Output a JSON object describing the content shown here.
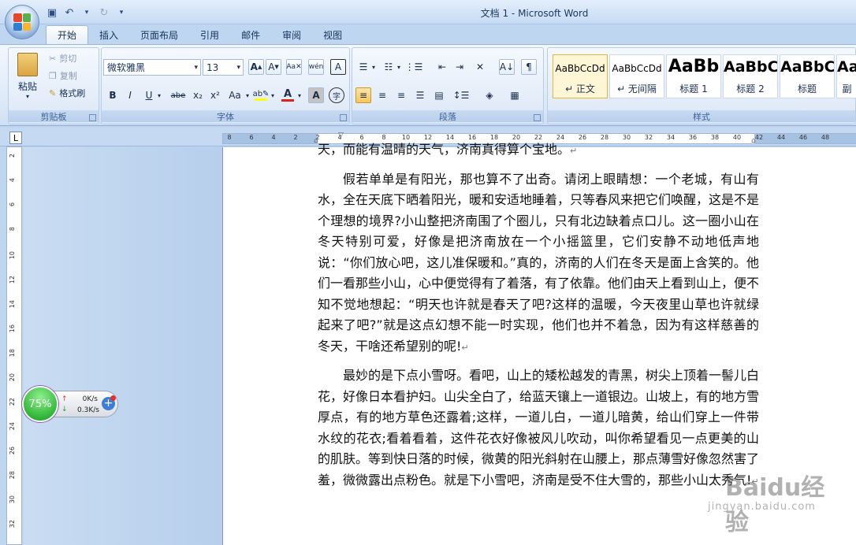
{
  "window": {
    "title": "文档 1 - Microsoft Word"
  },
  "colors": {
    "office_logo": [
      "#e8472a",
      "#5ab04a",
      "#2e7fd3",
      "#f7b42c"
    ],
    "highlight": "#ffff00",
    "font_color": "#e0201a"
  },
  "tabs": [
    "开始",
    "插入",
    "页面布局",
    "引用",
    "邮件",
    "审阅",
    "视图"
  ],
  "ribbon": {
    "clipboard": {
      "paste": "粘贴",
      "cut": "剪切",
      "copy": "复制",
      "format_painter": "格式刷",
      "label": "剪贴板"
    },
    "font": {
      "family": "微软雅黑",
      "size": "13",
      "label": "字体",
      "bold": "B",
      "italic": "I",
      "underline": "U",
      "strike": "abe",
      "sub": "x₂",
      "sup": "x²",
      "case": "Aa",
      "font_color_glyph": "A"
    },
    "paragraph": {
      "label": "段落"
    },
    "styles": {
      "label": "样式",
      "items": [
        {
          "sample": "AaBbCcDd",
          "name": "↵ 正文"
        },
        {
          "sample": "AaBbCcDd",
          "name": "↵ 无间隔"
        },
        {
          "sample": "AaBb",
          "name": "标题 1"
        },
        {
          "sample": "AaBbC",
          "name": "标题 2"
        },
        {
          "sample": "AaBbC",
          "name": "标题"
        },
        {
          "sample": "Aa",
          "name": "副"
        }
      ]
    }
  },
  "ruler": {
    "corner": "L",
    "h_ticks": [
      "8",
      "6",
      "4",
      "2",
      "2",
      "4",
      "6",
      "8",
      "10",
      "12",
      "14",
      "16",
      "18",
      "20",
      "22",
      "24",
      "26",
      "28",
      "30",
      "32",
      "34",
      "36",
      "38",
      "40",
      "42",
      "44",
      "46",
      "48"
    ],
    "v_ticks": [
      "2",
      "4",
      "6",
      "8",
      "10",
      "12",
      "14",
      "16",
      "18",
      "20",
      "22",
      "24",
      "26",
      "28",
      "30",
      "32"
    ]
  },
  "document": {
    "top_line": "天，而能有温晴的天气，济南真得算个宝地。",
    "p1": "假若单单是有阳光，那也算不了出奇。请闭上眼睛想：一个老城，有山有水，全在天底下晒着阳光，暖和安适地睡着，只等春风来把它们唤醒，这是不是个理想的境界?小山整把济南围了个圈儿，只有北边缺着点口儿。这一圈小山在冬天特别可爱，好像是把济南放在一个小摇篮里，它们安静不动地低声地说：“你们放心吧，这儿准保暖和。”真的，济南的人们在冬天是面上含笑的。他们一看那些小山，心中便觉得有了着落，有了依靠。他们由天上看到山上，便不知不觉地想起：“明天也许就是春天了吧?这样的温暖，今天夜里山草也许就绿起来了吧?”就是这点幻想不能一时实现，他们也并不着急，因为有这样慈善的冬天，干啥还希望别的呢!",
    "p2": "最妙的是下点小雪呀。看吧，山上的矮松越发的青黑，树尖上顶着一髻儿白花，好像日本看护妇。山尖全白了，给蓝天镶上一道银边。山坡上，有的地方雪厚点，有的地方草色还露着;这样，一道儿白，一道儿暗黄，给山们穿上一件带水纹的花衣;看着看着，这件花衣好像被风儿吹动，叫你希望看见一点更美的山的肌肤。等到快日落的时候，微黄的阳光斜射在山腰上，那点薄雪好像忽然害了羞，微微露出点粉色。就是下小雪吧，济南是受不住大雪的，那些小山太秀气!",
    "para_mark": "↵"
  },
  "net_widget": {
    "percent": "75%",
    "up": "0K/s",
    "down": "0.3K/s",
    "plus": "+"
  },
  "watermark": {
    "brand": "Baidu经验",
    "url": "jingyan.baidu.com"
  }
}
